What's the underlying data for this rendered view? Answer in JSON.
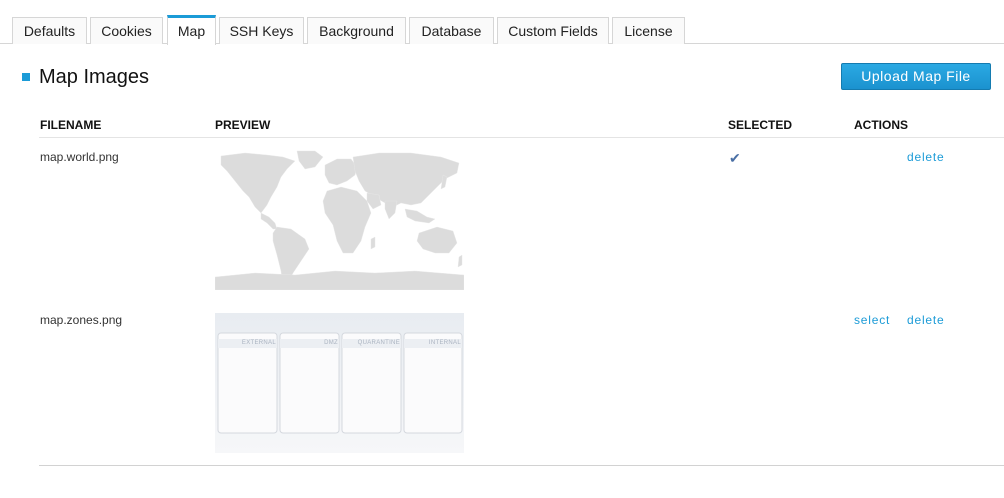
{
  "tabs": [
    {
      "label": "Defaults",
      "active": false
    },
    {
      "label": "Cookies",
      "active": false
    },
    {
      "label": "Map",
      "active": true
    },
    {
      "label": "SSH Keys",
      "active": false
    },
    {
      "label": "Background",
      "active": false
    },
    {
      "label": "Database",
      "active": false
    },
    {
      "label": "Custom Fields",
      "active": false
    },
    {
      "label": "License",
      "active": false
    }
  ],
  "section": {
    "title": "Map Images",
    "upload_label": "Upload Map File"
  },
  "table": {
    "headers": {
      "filename": "FILENAME",
      "preview": "PREVIEW",
      "selected": "SELECTED",
      "actions": "ACTIONS"
    },
    "rows": [
      {
        "filename": "map.world.png",
        "selected": true,
        "actions": {
          "delete": "delete"
        }
      },
      {
        "filename": "map.zones.png",
        "selected": false,
        "actions": {
          "select": "select",
          "delete": "delete"
        },
        "zones": [
          "EXTERNAL",
          "DMZ",
          "QUARANTINE",
          "INTERNAL"
        ]
      }
    ]
  },
  "colors": {
    "accent": "#1b9bd7",
    "check": "#4a6fa5"
  },
  "icons": {
    "section_marker": "square-bullet-icon",
    "selected": "checkmark-icon"
  }
}
